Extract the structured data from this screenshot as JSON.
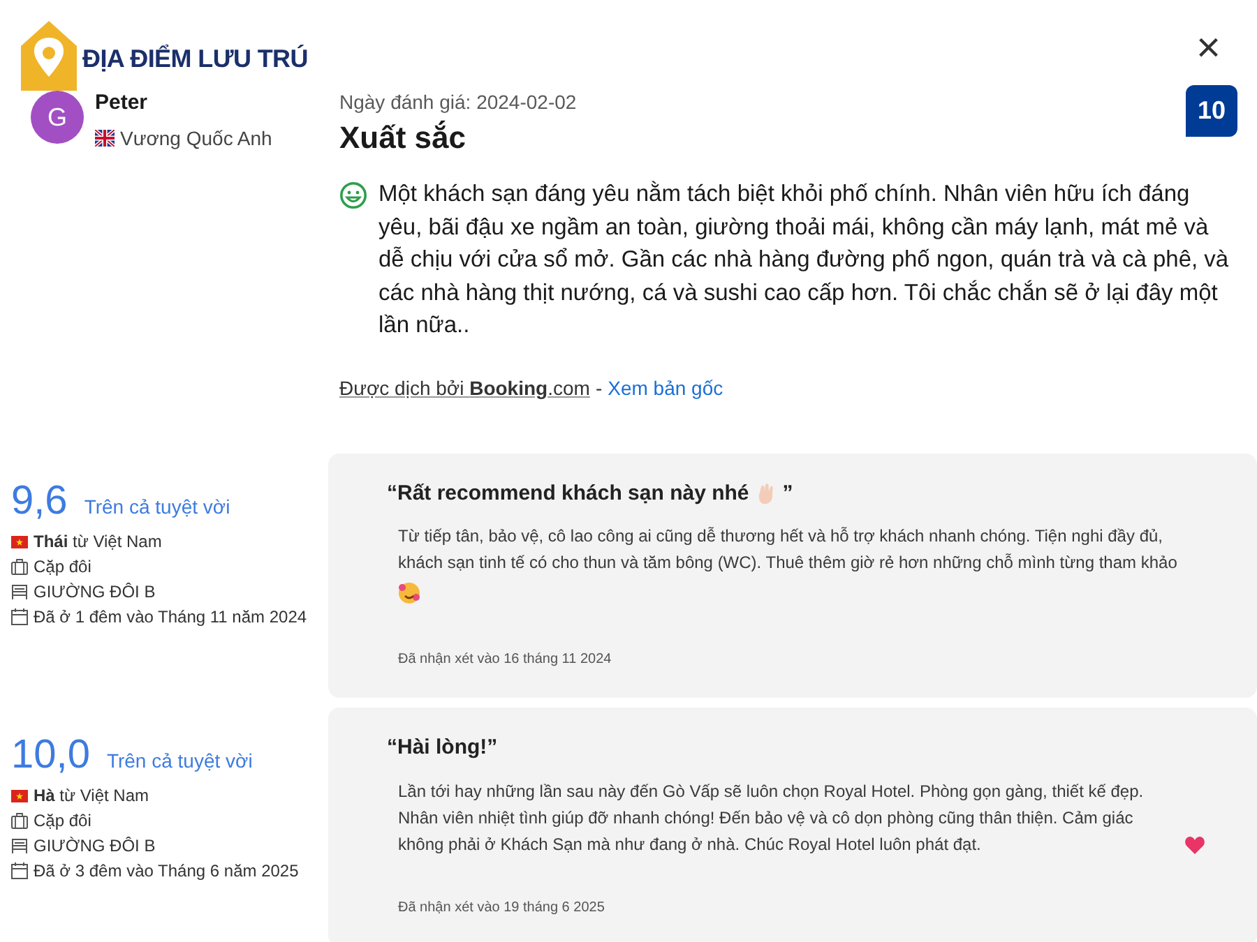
{
  "brand": {
    "name": "ĐỊA ĐIỂM LƯU TRÚ"
  },
  "close_button": {
    "label": "×"
  },
  "reviewer": {
    "avatar_letter": "G",
    "name": "Peter",
    "country": "Vương Quốc Anh"
  },
  "review": {
    "date_label": "Ngày đánh giá: 2024-02-02",
    "title": "Xuất sắc",
    "score": "10",
    "text": "Một khách sạn đáng yêu nằm tách biệt khỏi phố chính. Nhân viên hữu ích đáng yêu, bãi đậu xe ngầm an toàn, giường thoải mái, không cần máy lạnh, mát mẻ và dễ chịu với cửa sổ mở. Gần các nhà hàng đường phố ngon, quán trà và cà phê, và các nhà hàng thịt nướng, cá và sushi cao cấp hơn. Tôi chắc chắn sẽ ở lại đây một lần nữa..",
    "translation_credit": "Được dịch bởi **Booking**.com",
    "separator": "-",
    "original_link": "Xem bản gốc"
  },
  "other_reviews": [
    {
      "score": "9,6",
      "score_label": "Trên cả tuyệt vời",
      "guest": "**Thái** từ Việt Nam",
      "trip_type": "Cặp đôi",
      "room": "GIƯỜNG ĐÔI B",
      "stay": "Đã ở 1 đêm vào Tháng 11 năm 2024",
      "quote_title": "“Rất recommend khách sạn này nhé",
      "quote_close": "”",
      "title_icon": true,
      "kind": "face",
      "body": "Từ tiếp tân, bảo vệ, cô lao công ai cũng dễ thương hết và hỗ trợ khách nhanh chóng. Tiện nghi đầy đủ, khách sạn tinh tế có cho thun và tăm bông (WC). Thuê thêm giờ rẻ hơn những chỗ mình từng tham khảo",
      "reviewed_date": "Đã nhận xét vào 16 tháng 11 2024"
    },
    {
      "score": "10,0",
      "score_label": "Trên cả tuyệt vời",
      "guest": "**Hà** từ Việt Nam",
      "trip_type": "Cặp đôi",
      "room": "GIƯỜNG ĐÔI B",
      "stay": "Đã ở 3 đêm vào Tháng 6 năm 2025",
      "quote_title": "“Hài lòng!”",
      "kind": "heart",
      "body": "Lần tới hay những lần sau này đến Gò Vấp sẽ luôn chọn Royal Hotel. Phòng gọn gàng, thiết kế đẹp. Nhân viên nhiệt tình giúp đỡ nhanh chóng! Đến bảo vệ và cô dọn phòng cũng thân thiện. Cảm giác không phải ở Khách Sạn mà như đang ở nhà. Chúc Royal Hotel luôn phát đạt.",
      "reviewed_date": "Đã nhận xét vào 19 tháng 6 2025"
    }
  ]
}
